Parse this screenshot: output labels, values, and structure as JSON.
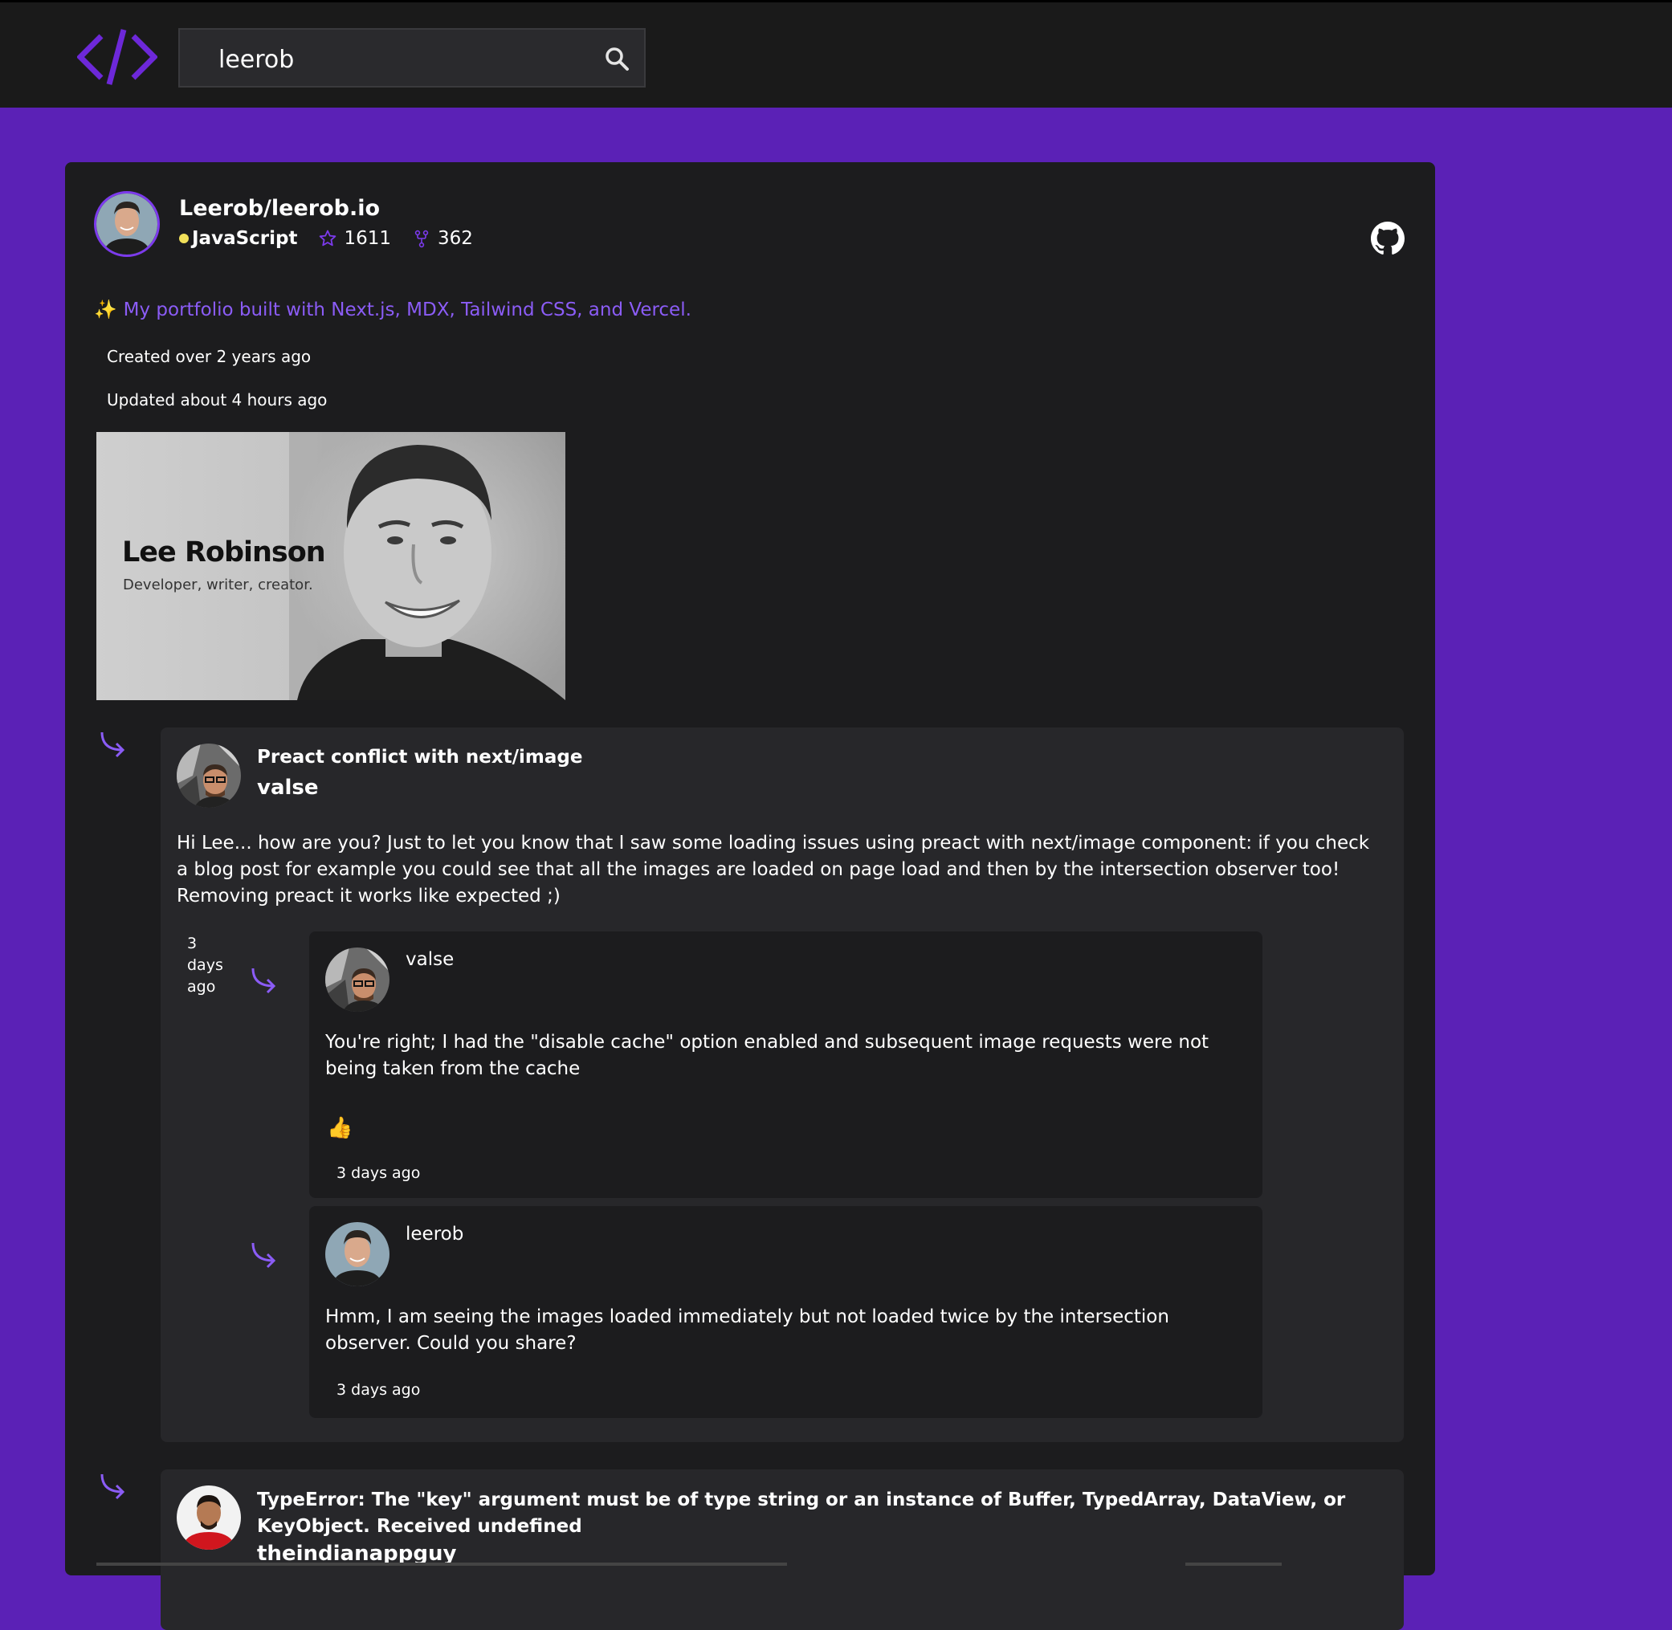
{
  "search": {
    "value": "leerob"
  },
  "repo": {
    "title": "Leerob/leerob.io",
    "language": "JavaScript",
    "stars": "1611",
    "forks": "362",
    "description": "My portfolio built with Next.js, MDX, Tailwind CSS, and Vercel.",
    "sparkle": "✨",
    "created": "Created over 2 years ago",
    "updated": "Updated about 4 hours ago",
    "preview": {
      "name": "Lee Robinson",
      "tagline": "Developer, writer, creator."
    }
  },
  "issues": [
    {
      "title": "Preact conflict with next/image",
      "author": "valse",
      "body": "Hi Lee... how are you? Just to let you know that I saw some loading issues using preact with next/image component: if you check a blog post for example you could see that all the images are loaded on page load and then by the intersection observer too! Removing preact it works like expected ;)",
      "date": "3 days ago",
      "comments": [
        {
          "author": "valse",
          "body": "You're right; I had the \"disable cache\" option enabled and subsequent image requests were not being taken from the cache",
          "reaction": "👍",
          "date": "3 days ago"
        },
        {
          "author": "leerob",
          "body": "Hmm, I am seeing the images loaded immediately but not loaded twice by the intersection observer. Could you share?",
          "date": "3 days ago"
        }
      ]
    },
    {
      "title": "TypeError: The \"key\" argument must be of type string or an instance of Buffer, TypedArray, DataView, or KeyObject. Received undefined",
      "author": "theindianappguy"
    }
  ],
  "colors": {
    "accent": "#7c3aed",
    "background": "#5b21b6",
    "topbar": "#1a1a1a",
    "card": "#1c1c1e",
    "issue": "#27272a",
    "description": "#8b5cf6",
    "language_dot": "#f1e05a"
  },
  "icons": {
    "logo": "code-brackets-logo",
    "search": "search-icon",
    "star": "star-icon",
    "fork": "fork-icon",
    "github": "github-icon",
    "reply": "reply-arrow-icon"
  }
}
